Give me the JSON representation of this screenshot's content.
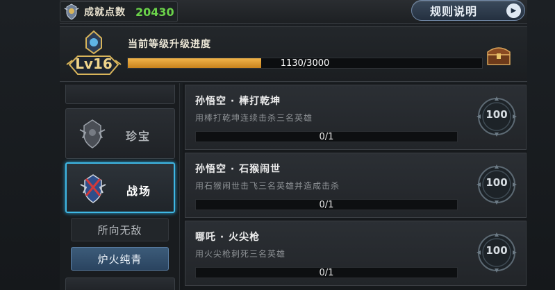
{
  "header": {
    "score_label": "成就点数",
    "score_value": "20430",
    "rules_label": "规则说明"
  },
  "level": {
    "badge": "Lv16",
    "title": "当前等级升级进度",
    "current": 1130,
    "max": 3000,
    "progress_text": "1130/3000",
    "progress_fraction": 0.3767
  },
  "categories": [
    {
      "label": "珍宝",
      "active": false
    },
    {
      "label": "战场",
      "active": true
    }
  ],
  "subcategories": [
    {
      "label": "所向无敌",
      "selected": false
    },
    {
      "label": "炉火纯青",
      "selected": true
    }
  ],
  "achievements": [
    {
      "title": "孙悟空 · 棒打乾坤",
      "desc": "用棒打乾坤连续击杀三名英雄",
      "progress": "0/1",
      "points": "100"
    },
    {
      "title": "孙悟空 · 石猴闹世",
      "desc": "用石猴闹世击飞三名英雄并造成击杀",
      "progress": "0/1",
      "points": "100"
    },
    {
      "title": "哪吒 · 火尖枪",
      "desc": "用火尖枪刺死三名英雄",
      "progress": "0/1",
      "points": "100"
    }
  ],
  "colors": {
    "score_green": "#6bd34a",
    "progress_orange": "#f1b44a",
    "active_blue": "#3fb8e5"
  },
  "icons": {
    "score": "trophy-badge-icon",
    "rules_arrow": "play-arrow-icon",
    "chest": "treasure-chest-icon",
    "treasure_category": "treasure-crest-icon",
    "battle_category": "battlefield-crest-icon",
    "medal": "achievement-medal-icon"
  }
}
